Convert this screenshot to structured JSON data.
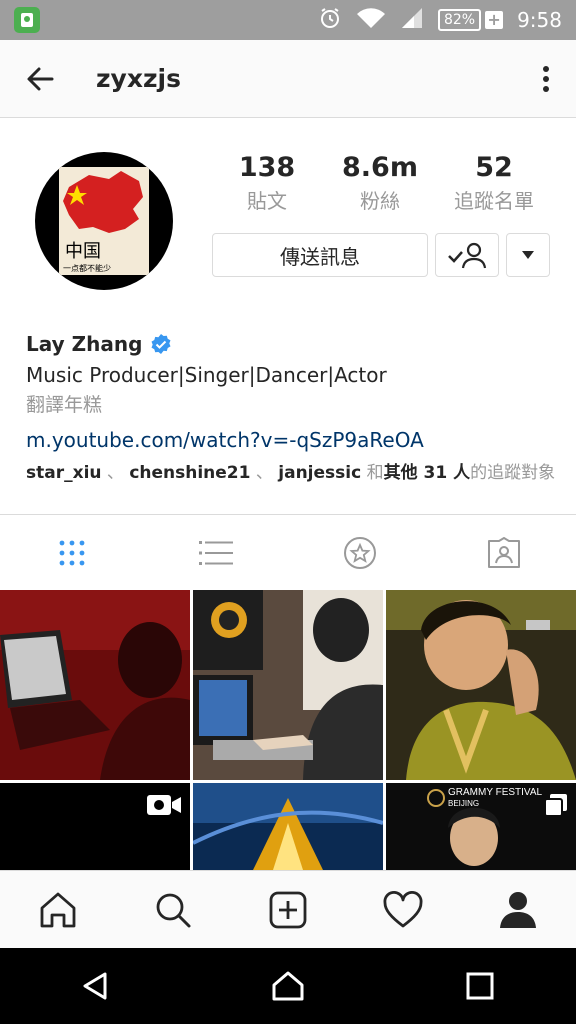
{
  "status_bar": {
    "battery": "82%",
    "time": "9:58"
  },
  "header": {
    "username": "zyxzjs"
  },
  "profile": {
    "stats": [
      {
        "value": "138",
        "label": "貼文"
      },
      {
        "value": "8.6m",
        "label": "粉絲"
      },
      {
        "value": "52",
        "label": "追蹤名單"
      }
    ],
    "message_button": "傳送訊息",
    "avatar_text": "中国",
    "avatar_subtext": "一点都不能少",
    "name": "Lay Zhang",
    "bio": "Music Producer|Singer|Dancer|Actor",
    "translate": "翻譯年糕",
    "link": "m.youtube.com/watch?v=-qSzP9aReOA",
    "followed_by": {
      "user1": "star_xiu",
      "user2": "chenshine21",
      "user3": "janjessic",
      "and": "和",
      "others": "其他 31 人",
      "suffix": "的追蹤對象",
      "sep": "、"
    }
  },
  "grid": {
    "grammy_line1": "GRAMMY FESTIVAL",
    "grammy_line2": "BEIJING"
  },
  "colors": {
    "accent": "#3897f0",
    "link": "#003569",
    "verified": "#3897f0"
  }
}
